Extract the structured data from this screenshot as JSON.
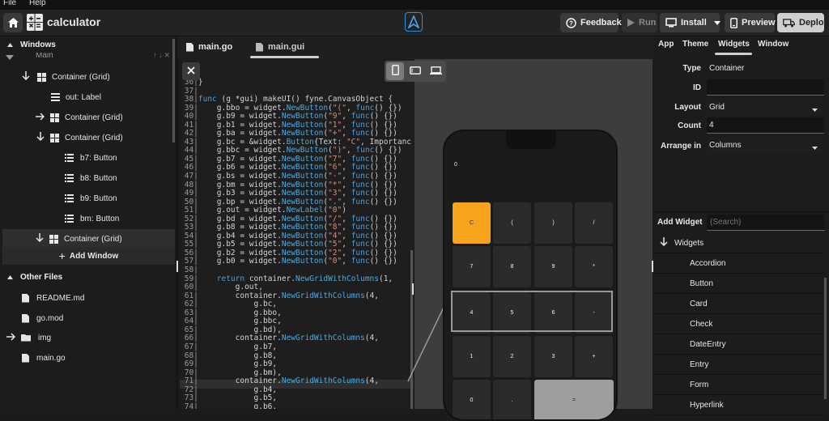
{
  "menu": {
    "file": "File",
    "help": "Help"
  },
  "app": {
    "title": "calculator"
  },
  "toolbar": {
    "feedback": "Feedback",
    "run": "Run",
    "install": "Install",
    "preview": "Preview",
    "deploy": "Deploy"
  },
  "left": {
    "windows_header": "Windows",
    "tree": [
      {
        "label": "Main"
      },
      {
        "label": "Container (Grid)"
      },
      {
        "label": "out: Label"
      },
      {
        "label": "Container (Grid)"
      },
      {
        "label": "Container (Grid)"
      },
      {
        "label": "b7: Button"
      },
      {
        "label": "b8: Button"
      },
      {
        "label": "b9: Button"
      },
      {
        "label": "bm: Button"
      },
      {
        "label": "Container (Grid)"
      }
    ],
    "add_window": "Add Window",
    "other_files_header": "Other Files",
    "files": [
      "README.md",
      "go.mod",
      "img",
      "main.go"
    ]
  },
  "editor": {
    "tabs": [
      "main.go",
      "main.gui"
    ],
    "lines": [
      [
        "36",
        "}"
      ],
      [
        "37",
        ""
      ],
      [
        "38",
        "func (g *gui) makeUI() fyne.CanvasObject {"
      ],
      [
        "39",
        "    g.bbo = widget.NewButton(\"(\", func() {})"
      ],
      [
        "40",
        "    g.b9 = widget.NewButton(\"9\", func() {})"
      ],
      [
        "41",
        "    g.b1 = widget.NewButton(\"1\", func() {})"
      ],
      [
        "42",
        "    g.ba = widget.NewButton(\"+\", func() {})"
      ],
      [
        "43",
        "    g.bc = &widget.Button{Text: \"C\", Importanc"
      ],
      [
        "44",
        "    g.bbc = widget.NewButton(\")\", func() {})"
      ],
      [
        "45",
        "    g.b7 = widget.NewButton(\"7\", func() {})"
      ],
      [
        "46",
        "    g.b6 = widget.NewButton(\"6\", func() {})"
      ],
      [
        "47",
        "    g.bs = widget.NewButton(\"-\", func() {})"
      ],
      [
        "48",
        "    g.bm = widget.NewButton(\"*\", func() {})"
      ],
      [
        "49",
        "    g.b3 = widget.NewButton(\"3\", func() {})"
      ],
      [
        "50",
        "    g.bp = widget.NewButton(\".\", func() {})"
      ],
      [
        "51",
        "    g.out = widget.NewLabel(\"0\")"
      ],
      [
        "52",
        "    g.bd = widget.NewButton(\"/\", func() {})"
      ],
      [
        "53",
        "    g.b8 = widget.NewButton(\"8\", func() {})"
      ],
      [
        "54",
        "    g.b4 = widget.NewButton(\"4\", func() {})"
      ],
      [
        "55",
        "    g.b5 = widget.NewButton(\"5\", func() {})"
      ],
      [
        "56",
        "    g.b2 = widget.NewButton(\"2\", func() {})"
      ],
      [
        "57",
        "    g.b0 = widget.NewButton(\"0\", func() {})"
      ],
      [
        "58",
        ""
      ],
      [
        "59",
        "    return container.NewGridWithColumns(1,"
      ],
      [
        "60",
        "        g.out,"
      ],
      [
        "61",
        "        container.NewGridWithColumns(4,"
      ],
      [
        "62",
        "            g.bc,"
      ],
      [
        "63",
        "            g.bbo,"
      ],
      [
        "64",
        "            g.bbc,"
      ],
      [
        "65",
        "            g.bd),"
      ],
      [
        "66",
        "        container.NewGridWithColumns(4,"
      ],
      [
        "67",
        "            g.b7,"
      ],
      [
        "68",
        "            g.b8,"
      ],
      [
        "69",
        "            g.b9,"
      ],
      [
        "70",
        "            g.bm),"
      ],
      [
        "71",
        "        container.NewGridWithColumns(4,"
      ],
      [
        "72",
        "            g.b4,"
      ],
      [
        "73",
        "            g.b5,"
      ],
      [
        "74",
        "            g.b6,"
      ]
    ]
  },
  "phone": {
    "display": "0",
    "rows": [
      [
        "C",
        "(",
        ")",
        "/"
      ],
      [
        "7",
        "8",
        "9",
        "*"
      ],
      [
        "4",
        "5",
        "6",
        "-"
      ],
      [
        "1",
        "2",
        "3",
        "+"
      ],
      [
        "0",
        ".",
        "="
      ]
    ]
  },
  "right": {
    "tabs": [
      "App",
      "Theme",
      "Widgets",
      "Window"
    ],
    "props": {
      "type_label": "Type",
      "type_value": "Container",
      "id_label": "ID",
      "id_value": "",
      "layout_label": "Layout",
      "layout_value": "Grid",
      "count_label": "Count",
      "count_value": "4",
      "arrange_label": "Arrange in",
      "arrange_value": "Columns"
    },
    "add_widget": "Add Widget",
    "search_placeholder": "(Search)",
    "widgets_header": "Widgets",
    "widgets": [
      "Accordion",
      "Button",
      "Card",
      "Check",
      "DateEntry",
      "Entry",
      "Form",
      "Hyperlink"
    ]
  },
  "colors": {
    "accent": "#f7a31c",
    "brand": "#2f8ee0",
    "selected_button": "#9e9e9e"
  },
  "icons": [
    "home-icon",
    "calculator-icon",
    "app-logo-icon",
    "feedback-icon",
    "play-icon",
    "monitor-icon",
    "chevron-down-icon",
    "phone-icon",
    "tablet-icon",
    "laptop-icon",
    "close-icon",
    "truck-icon",
    "arrow-down-icon",
    "arrow-right-icon"
  ]
}
